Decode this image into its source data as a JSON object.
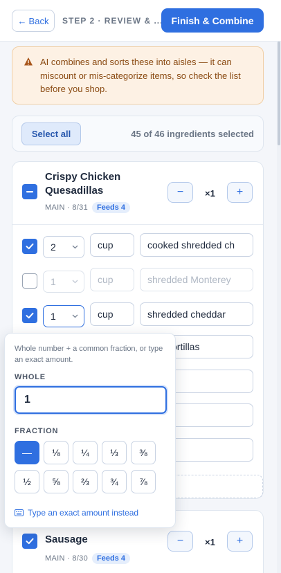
{
  "header": {
    "back_label": "Back",
    "step_label": "STEP 2 · REVIEW & ...",
    "finish_label": "Finish & Combine"
  },
  "warning": {
    "text": "AI combines and sorts these into aisles — it can miscount or mis-categorize items, so check the list before you shop.",
    "color": "#8a4a12"
  },
  "selection": {
    "select_all_label": "Select all",
    "count_text": "45 of 46 ingredients selected"
  },
  "recipes": [
    {
      "title": "Crispy Chicken Quesadillas",
      "meta": "MAIN · 8/31",
      "badge": "Feeds 4",
      "multiplier": "×1",
      "checked": "partial",
      "ingredients": [
        {
          "qty": "2",
          "unit": "cup",
          "name": "cooked shredded ch",
          "checked": true
        },
        {
          "qty": "1",
          "unit": "cup",
          "name": "shredded Monterey",
          "checked": false
        },
        {
          "qty": "1",
          "unit": "cup",
          "name": "shredded cheddar",
          "checked": true
        },
        {
          "qty": "",
          "unit": "",
          "name": "flour tortillas",
          "checked": true
        },
        {
          "qty": "",
          "unit": "",
          "name": "",
          "checked": true
        },
        {
          "qty": "",
          "unit": "",
          "name": ".",
          "checked": true
        },
        {
          "qty": "",
          "unit": "",
          "name": "ream",
          "checked": true
        }
      ]
    },
    {
      "title": "Sausage",
      "meta": "MAIN · 8/30",
      "badge": "Feeds 4",
      "multiplier": "×1",
      "checked": true
    }
  ],
  "popover": {
    "hint": "Whole number + a common fraction, or type an exact amount.",
    "whole_label": "WHOLE",
    "whole_value": "1",
    "fraction_label": "FRACTION",
    "fractions": [
      "—",
      "⅛",
      "¼",
      "⅓",
      "⅜",
      "½",
      "⅝",
      "⅔",
      "¾",
      "⅞"
    ],
    "selected_fraction": "—",
    "exact_link": "Type an exact amount instead"
  },
  "colors": {
    "accent": "#2f6fe0",
    "warning_bg": "#fdf1e4",
    "page_bg": "#f4f6fa"
  }
}
